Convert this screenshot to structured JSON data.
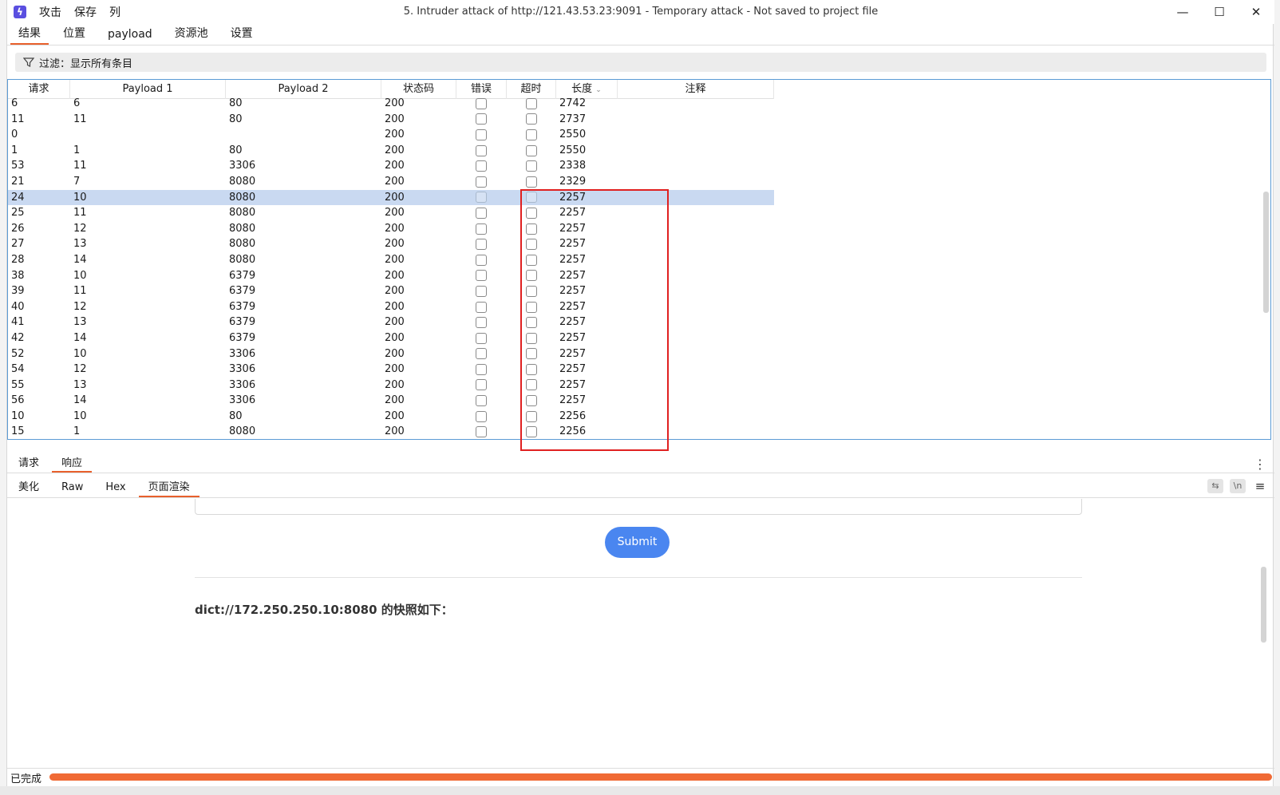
{
  "titlebar": {
    "menu": [
      "攻击",
      "保存",
      "列"
    ],
    "title": "5. Intruder attack of http://121.43.53.23:9091 - Temporary attack - Not saved to project file"
  },
  "top_tabs": [
    "结果",
    "位置",
    "payload",
    "资源池",
    "设置"
  ],
  "filter": {
    "label": "过滤：显示所有条目"
  },
  "table": {
    "columns": [
      "请求",
      "Payload 1",
      "Payload 2",
      "状态码",
      "错误",
      "超时",
      "长度",
      "注释"
    ],
    "sort_icon": "chevron-down-icon",
    "rows": [
      [
        "6",
        "6",
        "80",
        "200",
        "2742"
      ],
      [
        "11",
        "11",
        "80",
        "200",
        "2737"
      ],
      [
        "0",
        "",
        "",
        "200",
        "2550"
      ],
      [
        "1",
        "1",
        "80",
        "200",
        "2550"
      ],
      [
        "53",
        "11",
        "3306",
        "200",
        "2338"
      ],
      [
        "21",
        "7",
        "8080",
        "200",
        "2329"
      ],
      [
        "24",
        "10",
        "8080",
        "200",
        "2257"
      ],
      [
        "25",
        "11",
        "8080",
        "200",
        "2257"
      ],
      [
        "26",
        "12",
        "8080",
        "200",
        "2257"
      ],
      [
        "27",
        "13",
        "8080",
        "200",
        "2257"
      ],
      [
        "28",
        "14",
        "8080",
        "200",
        "2257"
      ],
      [
        "38",
        "10",
        "6379",
        "200",
        "2257"
      ],
      [
        "39",
        "11",
        "6379",
        "200",
        "2257"
      ],
      [
        "40",
        "12",
        "6379",
        "200",
        "2257"
      ],
      [
        "41",
        "13",
        "6379",
        "200",
        "2257"
      ],
      [
        "42",
        "14",
        "6379",
        "200",
        "2257"
      ],
      [
        "52",
        "10",
        "3306",
        "200",
        "2257"
      ],
      [
        "54",
        "12",
        "3306",
        "200",
        "2257"
      ],
      [
        "55",
        "13",
        "3306",
        "200",
        "2257"
      ],
      [
        "56",
        "14",
        "3306",
        "200",
        "2257"
      ],
      [
        "10",
        "10",
        "80",
        "200",
        "2256"
      ],
      [
        "15",
        "1",
        "8080",
        "200",
        "2256"
      ]
    ],
    "selected_request": "24"
  },
  "req_resp_tabs": [
    "请求",
    "响应"
  ],
  "view_tabs": [
    "美化",
    "Raw",
    "Hex",
    "页面渲染"
  ],
  "view_icons": {
    "wrap": "⇆",
    "newline": "\\n",
    "menu": "≡"
  },
  "rendered": {
    "submit_label": "Submit",
    "snapshot_text": "dict://172.250.250.10:8080 的快照如下："
  },
  "status": {
    "text": "已完成"
  },
  "colors": {
    "accent": "#e8602c",
    "selected_row": "#c9d9f1",
    "highlight_box": "#e02020",
    "progress": "#f06a35",
    "button": "#4a86f0"
  }
}
